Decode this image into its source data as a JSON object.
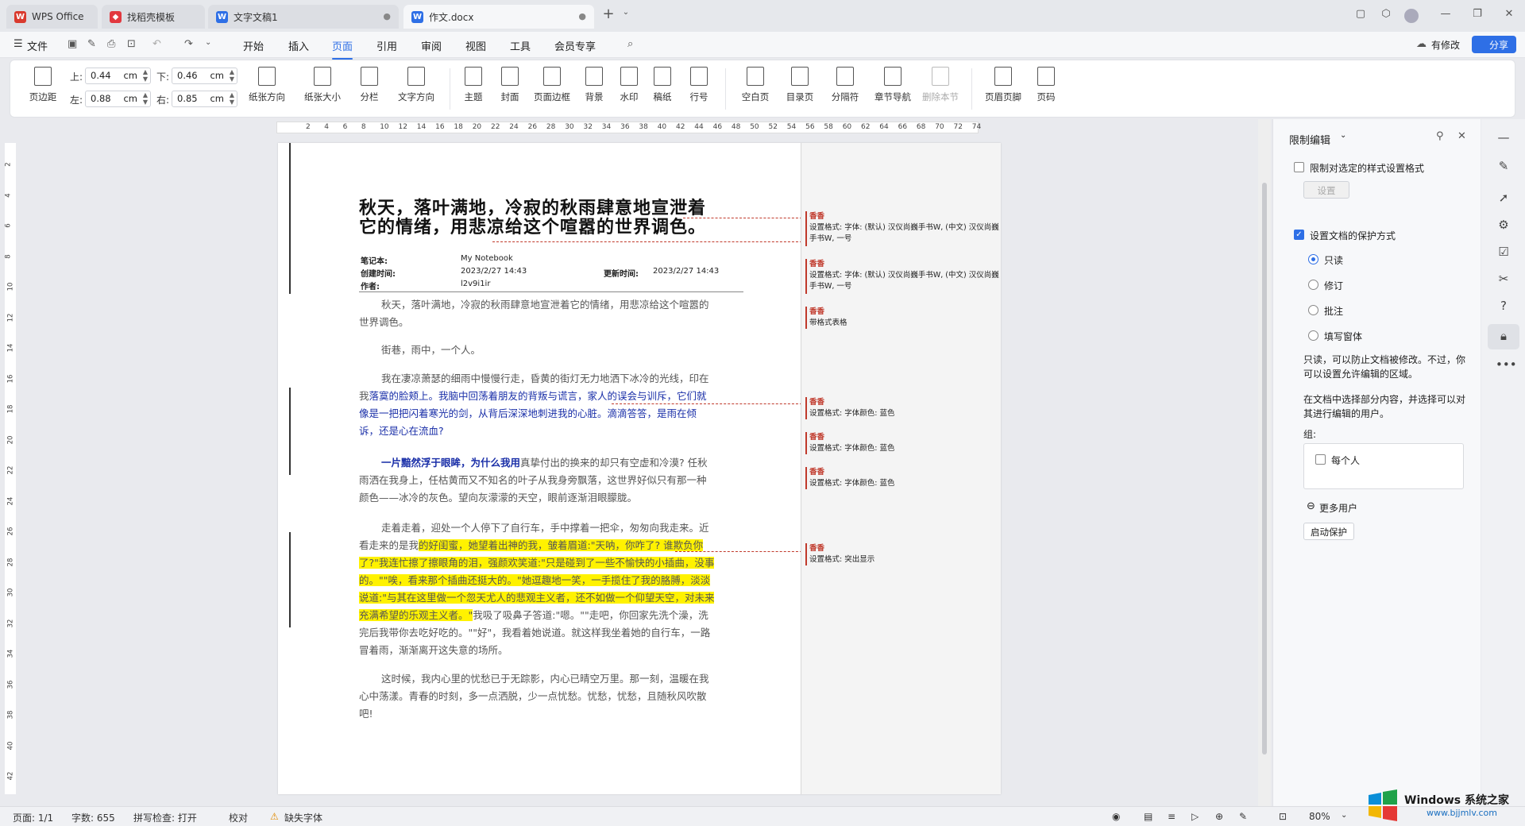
{
  "tabs": [
    {
      "label": "WPS Office",
      "icon": "wps-logo-icon",
      "color": "#d93a2e"
    },
    {
      "label": "找稻壳模板",
      "icon": "docer-icon",
      "color": "#e2383f"
    },
    {
      "label": "文字文稿1",
      "icon": "word-doc-icon",
      "color": "#2e6fe6"
    },
    {
      "label": "作文.docx",
      "icon": "word-doc-icon",
      "color": "#2e6fe6"
    }
  ],
  "menu": {
    "file": "文件",
    "items": [
      "开始",
      "插入",
      "页面",
      "引用",
      "审阅",
      "视图",
      "工具",
      "会员专享"
    ],
    "active": "页面",
    "modified": "有修改",
    "share": "分享"
  },
  "ribbon": {
    "margins": "页边距",
    "top_label": "上:",
    "top": "0.44",
    "bottom_label": "下:",
    "bottom": "0.46",
    "left_label": "左:",
    "left": "0.88",
    "right_label": "右:",
    "right": "0.85",
    "unit": "cm",
    "buttons": [
      "纸张方向",
      "纸张大小",
      "分栏",
      "文字方向",
      "主题",
      "封面",
      "页面边框",
      "背景",
      "水印",
      "稿纸",
      "行号",
      "空白页",
      "目录页",
      "分隔符",
      "章节导航",
      "删除本节",
      "页眉页脚",
      "页码"
    ]
  },
  "ruler": {
    "ticks": [
      "2",
      "4",
      "6",
      "8",
      "10",
      "12",
      "14",
      "16",
      "18",
      "20",
      "22",
      "24",
      "26",
      "28",
      "30",
      "32",
      "34",
      "36",
      "38",
      "40",
      "42",
      "44",
      "46",
      "48",
      "50",
      "52",
      "54",
      "56",
      "58",
      "60",
      "62",
      "64",
      "66",
      "68",
      "70",
      "72",
      "74"
    ]
  },
  "vruler": {
    "ticks": [
      "2",
      "4",
      "6",
      "8",
      "10",
      "12",
      "14",
      "16",
      "18",
      "20",
      "22",
      "24",
      "26",
      "28",
      "30",
      "32",
      "34",
      "36",
      "38",
      "40",
      "42"
    ]
  },
  "doc": {
    "title": "秋天，落叶满地，冷寂的秋雨肆意地宣泄着它的情绪，用悲凉给这个喧嚣的世界调色。",
    "meta": {
      "notebook_label": "笔记本:",
      "notebook": "My Notebook",
      "created_label": "创建时间:",
      "created": "2023/2/27 14:43",
      "updated_label": "更新时间:",
      "updated": "2023/2/27 14:43",
      "author_label": "作者:",
      "author": "l2v9i1ir"
    },
    "p1": "秋天，落叶满地，冷寂的秋雨肆意地宣泄着它的情绪，用悲凉给这个喧嚣的世界调色。",
    "p2": "街巷，雨中，一个人。",
    "p3a": "我在凄凉萧瑟的细雨中慢慢行走，昏黄的街灯无力地洒下冰冷的光线，印在我",
    "p3b": "落寞的脸颊上。我脑中回荡着朋友的背叛与谎言，家人的误会与训斥，它们就像是一把把闪着寒光的剑，从背后深深地刺进我的心脏。滴滴答答，是雨在倾诉，还是心在流血?",
    "p4a": "一片黯然浮于眼眸，为什么我用",
    "p4b": "真挚付出的换来的却只有空虚和冷漠? 任秋雨洒在我身上，任枯黄而又不知名的叶子从我身旁飘落，这世界好似只有那一种颜色——冰冷的灰色。望向灰濛濛的天空，眼前逐渐泪眼朦胧。",
    "p5a": "走着走着，迎处一个人停下了自行车，手中撑着一把伞，匆匆向我走来。近看走来的是我",
    "p5b": "的好闺蜜，她望着出神的我，皱着眉道:\"天呐，你咋了? 谁欺负你了?\"我连忙擦了擦眼角的泪，强颜欢笑道:\"只是碰到了一些不愉快的小插曲，没事的。\"\"唉，看来那个插曲还挺大的。\"她逗趣地一笑，一手揽住了我的胳膊，淡淡说道:\"与其在这里做一个忽天尤人的悲观主义者，还不如做一个仰望天空，对未来充满希望的乐观主义者。\"",
    "p5c": "我吸了吸鼻子答道:\"嗯。\"\"走吧，你回家先洗个澡，洗完后我带你去吃好吃的。\"\"好\"，我看着她说道。就这样我坐着她的自行车，一路冒着雨，渐渐离开这失意的场所。",
    "p6": "这时候，我内心里的忧愁已于无踪影，内心已晴空万里。那一刻，温暖在我心中荡漾。青春的时刻，多一点洒脱，少一点忧愁。忧愁，忧愁，且随秋风吹散吧!"
  },
  "comments": [
    {
      "author": "香香",
      "text": "设置格式: 字体: (默认) 汉仪尚巍手书W, (中文) 汉仪尚巍手书W, 一号"
    },
    {
      "author": "香香",
      "text": "设置格式: 字体: (默认) 汉仪尚巍手书W, (中文) 汉仪尚巍手书W, 一号"
    },
    {
      "author": "香香",
      "text": "带格式表格"
    },
    {
      "author": "香香",
      "text": "设置格式: 字体颜色: 蓝色"
    },
    {
      "author": "香香",
      "text": "设置格式: 字体颜色: 蓝色"
    },
    {
      "author": "香香",
      "text": "设置格式: 字体颜色: 蓝色"
    },
    {
      "author": "香香",
      "text": "设置格式: 突出显示"
    }
  ],
  "panel": {
    "title": "限制编辑",
    "restrict_format": "限制对选定的样式设置格式",
    "settings_btn": "设置",
    "set_protection": "设置文档的保护方式",
    "options": [
      "只读",
      "修订",
      "批注",
      "填写窗体"
    ],
    "selected": "只读",
    "desc1": "只读，可以防止文档被修改。不过，你可以设置允许编辑的区域。",
    "desc2": "在文档中选择部分内容，并选择可以对其进行编辑的用户。",
    "group_label": "组:",
    "everyone": "每个人",
    "more_users": "更多用户",
    "start_btn": "启动保护"
  },
  "status": {
    "page": "页面: 1/1",
    "words": "字数: 655",
    "spell": "拼写检查: 打开",
    "proof": "校对",
    "missing_font": "缺失字体",
    "zoom": "80%"
  },
  "watermark": {
    "brand": "Windows 系统之家",
    "url": "www.bjjmlv.com"
  }
}
